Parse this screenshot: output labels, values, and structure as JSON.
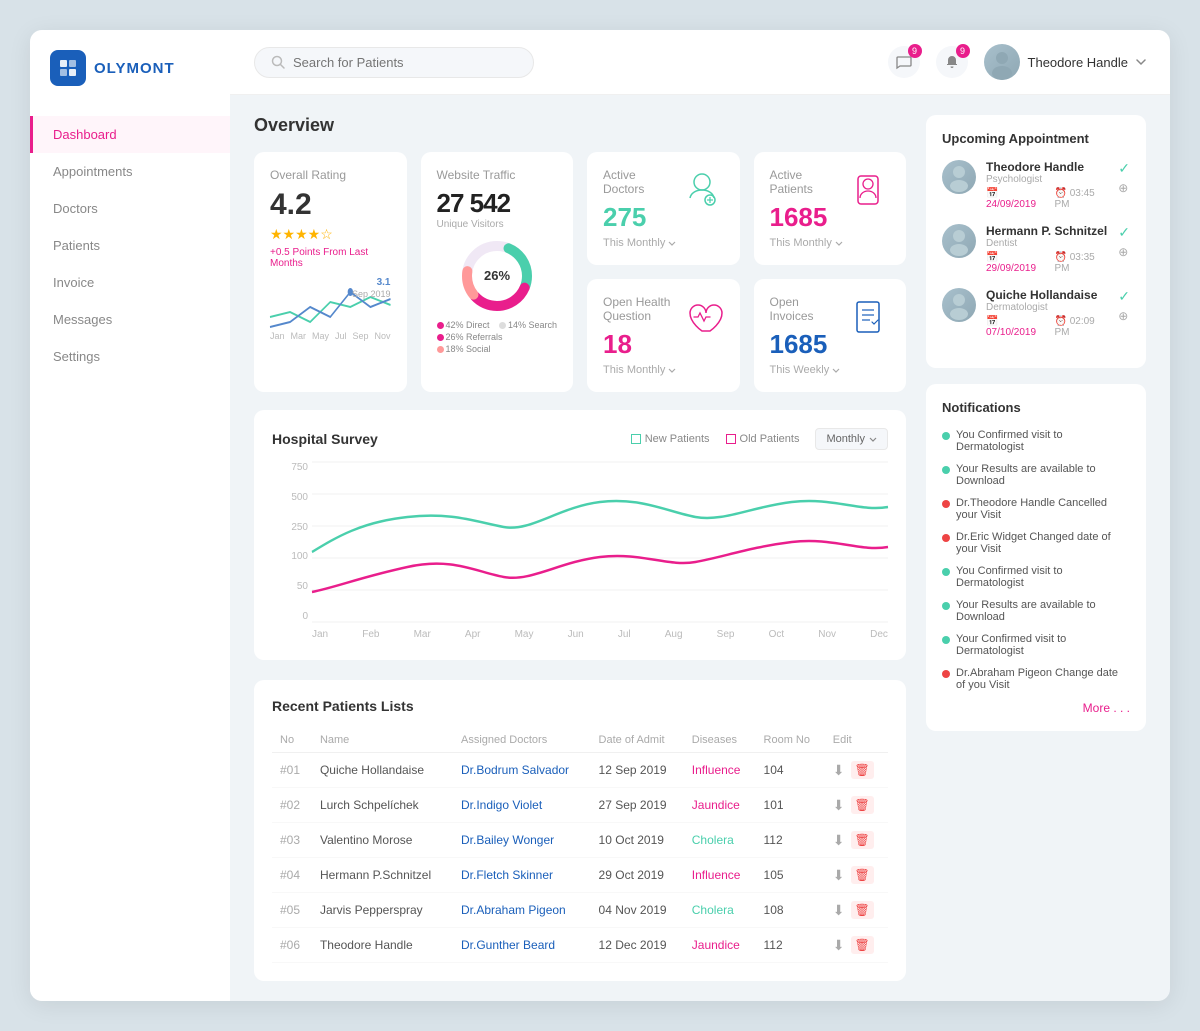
{
  "app": {
    "name": "OLYMONT",
    "logo_letter": "H"
  },
  "header": {
    "search_placeholder": "Search for Patients",
    "notifications_count": "9",
    "messages_count": "9",
    "user_name": "Theodore Handle"
  },
  "sidebar": {
    "items": [
      {
        "label": "Dashboard",
        "active": true
      },
      {
        "label": "Appointments",
        "active": false
      },
      {
        "label": "Doctors",
        "active": false
      },
      {
        "label": "Patients",
        "active": false
      },
      {
        "label": "Invoice",
        "active": false
      },
      {
        "label": "Messages",
        "active": false
      },
      {
        "label": "Settings",
        "active": false
      }
    ]
  },
  "overview": {
    "title": "Overview",
    "overall_rating": {
      "title": "Overall Rating",
      "value": "4.2",
      "stars": "★★★★☆",
      "note": "+0.5 Points From Last Months",
      "point_label": "3.1",
      "point_date": "Sep 2019"
    },
    "website_traffic": {
      "title": "Website Traffic",
      "value": "27 542",
      "sub": "Unique Visitors",
      "donut_percent": "26%",
      "legend": [
        {
          "label": "42% Direct",
          "color": "#e91e8c"
        },
        {
          "label": "14% Search",
          "color": "#aaa"
        },
        {
          "label": "26% Referrals",
          "color": "#e91e8c"
        },
        {
          "label": "18% Social",
          "color": "#f77"
        }
      ]
    },
    "active_doctors": {
      "title": "Active Doctors",
      "value": "275",
      "period": "This Monthly"
    },
    "open_health": {
      "title": "Open Health Question",
      "value": "18",
      "period": "This Monthly"
    },
    "active_patients": {
      "title": "Active Patients",
      "value": "1685",
      "period": "This Monthly"
    },
    "open_invoices": {
      "title": "Open Invoices",
      "value": "1685",
      "period": "This Weekly"
    }
  },
  "hospital_survey": {
    "title": "Hospital Survey",
    "legend": [
      {
        "label": "New Patients",
        "color": "#4acfac"
      },
      {
        "label": "Old Patients",
        "color": "#e91e8c"
      }
    ],
    "period": "Monthly",
    "x_labels": [
      "Jan",
      "Feb",
      "Mar",
      "Apr",
      "May",
      "Jun",
      "Jul",
      "Aug",
      "Sep",
      "Oct",
      "Nov",
      "Dec"
    ],
    "y_labels": [
      "750",
      "500",
      "250",
      "100",
      "50",
      "0"
    ]
  },
  "recent_patients": {
    "title": "Recent Patients Lists",
    "columns": [
      "No",
      "Name",
      "Assigned Doctors",
      "Date of Admit",
      "Diseases",
      "Room No",
      "Edit"
    ],
    "rows": [
      {
        "no": "#01",
        "name": "Quiche Hollandaise",
        "doctor": "Dr.Bodrum Salvador",
        "date": "12 Sep 2019",
        "disease": "Influence",
        "room": "104"
      },
      {
        "no": "#02",
        "name": "Lurch Schpelíchek",
        "doctor": "Dr.Indigo Violet",
        "date": "27 Sep 2019",
        "disease": "Jaundice",
        "room": "101"
      },
      {
        "no": "#03",
        "name": "Valentino Morose",
        "doctor": "Dr.Bailey Wonger",
        "date": "10 Oct 2019",
        "disease": "Cholera",
        "room": "112"
      },
      {
        "no": "#04",
        "name": "Hermann P.Schnitzel",
        "doctor": "Dr.Fletch Skinner",
        "date": "29 Oct 2019",
        "disease": "Influence",
        "room": "105"
      },
      {
        "no": "#05",
        "name": "Jarvis Pepperspray",
        "doctor": "Dr.Abraham Pigeon",
        "date": "04 Nov 2019",
        "disease": "Cholera",
        "room": "108"
      },
      {
        "no": "#06",
        "name": "Theodore Handle",
        "doctor": "Dr.Gunther Beard",
        "date": "12 Dec 2019",
        "disease": "Jaundice",
        "room": "112"
      }
    ]
  },
  "upcoming_appointment": {
    "title": "Upcoming Appointment",
    "items": [
      {
        "name": "Theodore Handle",
        "role": "Psychologist",
        "date": "24/09/2019",
        "time": "03:45 PM"
      },
      {
        "name": "Hermann P. Schnitzel",
        "role": "Dentist",
        "date": "29/09/2019",
        "time": "03:35 PM"
      },
      {
        "name": "Quiche Hollandaise",
        "role": "Dermatologist",
        "date": "07/10/2019",
        "time": "02:09 PM"
      }
    ]
  },
  "notifications": {
    "title": "Notifications",
    "items": [
      {
        "text": "You Confirmed visit to Dermatologist",
        "color": "#4acfac"
      },
      {
        "text": "Your Results are available to Download",
        "color": "#4acfac"
      },
      {
        "text": "Dr.Theodore Handle Cancelled your Visit",
        "color": "#e44"
      },
      {
        "text": "Dr.Eric Widget Changed date of your Visit",
        "color": "#e44"
      },
      {
        "text": "You Confirmed visit to Dermatologist",
        "color": "#4acfac"
      },
      {
        "text": "Your Results are available to Download",
        "color": "#4acfac"
      },
      {
        "text": "Your Confirmed visit to Dermatologist",
        "color": "#4acfac"
      },
      {
        "text": "Dr.Abraham Pigeon Change date of you Visit",
        "color": "#e44"
      }
    ],
    "more_label": "More . . ."
  },
  "colors": {
    "accent_pink": "#e91e8c",
    "accent_teal": "#4acfac",
    "accent_blue": "#1a5fba",
    "text_dark": "#333",
    "text_light": "#aaa"
  }
}
